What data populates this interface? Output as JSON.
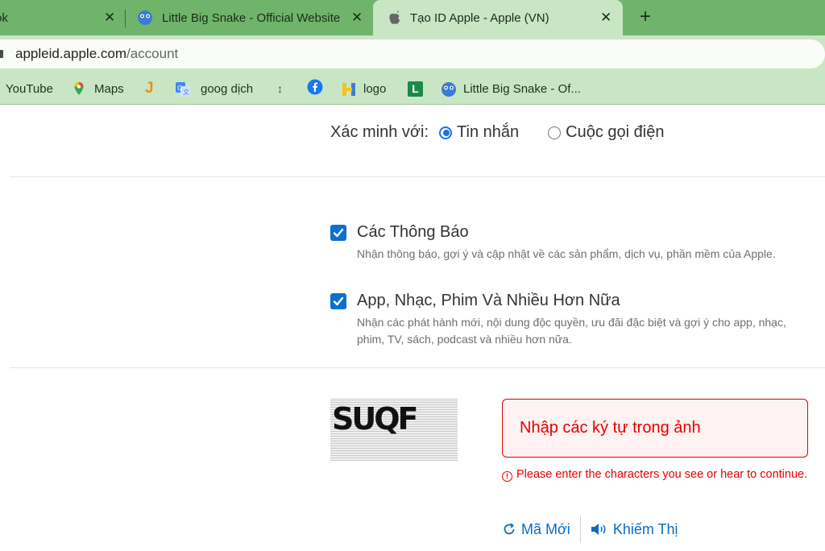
{
  "tabs": [
    {
      "title": "ok",
      "close_icon": "close-icon"
    },
    {
      "title": "Little Big Snake - Official Website",
      "close_icon": "close-icon"
    },
    {
      "title": "Tạo ID Apple - Apple (VN)",
      "close_icon": "close-icon",
      "active": true
    }
  ],
  "new_tab_label": "+",
  "address_bar": {
    "domain": "appleid.apple.com",
    "path": "/account"
  },
  "bookmarks": [
    {
      "label": "YouTube",
      "icon": "youtube-icon"
    },
    {
      "label": "Maps",
      "icon": "maps-pin-icon"
    },
    {
      "label": "",
      "icon": "j-logo-icon"
    },
    {
      "label": "goog dịch",
      "icon": "google-translate-icon"
    },
    {
      "label": "",
      "icon": "arrow-icon"
    },
    {
      "label": "",
      "icon": "facebook-icon"
    },
    {
      "label": "logo",
      "icon": "h-logo-icon"
    },
    {
      "label": "",
      "icon": "l-logo-icon"
    },
    {
      "label": "Little Big Snake - Of...",
      "icon": "snake-icon"
    }
  ],
  "verify": {
    "label": "Xác minh với:",
    "options": [
      {
        "label": "Tin nhắn",
        "selected": true
      },
      {
        "label": "Cuộc gọi điện",
        "selected": false
      }
    ]
  },
  "consents": [
    {
      "title": "Các Thông Báo",
      "description": "Nhận thông báo, gợi ý và cập nhật về các sản phẩm, dịch vụ, phần mềm của Apple.",
      "checked": true
    },
    {
      "title": "App, Nhạc, Phim Và Nhiều Hơn Nữa",
      "description": "Nhận các phát hành mới, nội dung độc quyền, ưu đãi đặc biệt và gợi ý cho app, nhạc, phim, TV, sách, podcast và nhiều hơn nữa.",
      "checked": true
    }
  ],
  "captcha": {
    "image_text": "SUQF",
    "placeholder": "Nhập các ký tự trong ảnh",
    "value": "",
    "error": "Please enter the characters you see or hear to continue.",
    "new_code_label": "Mã Mới",
    "audio_label": "Khiếm Thị"
  },
  "colors": {
    "tab_strip": "#6fb46a",
    "toolbar": "#c8e6c4",
    "accent": "#0d6fd0",
    "error": "#e30000"
  }
}
